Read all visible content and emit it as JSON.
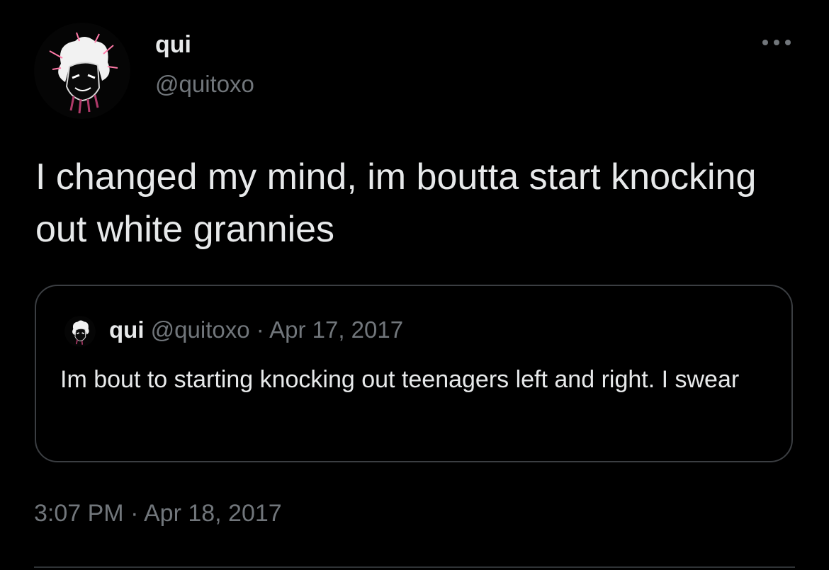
{
  "tweet": {
    "author": {
      "name": "qui",
      "handle": "@quitoxo",
      "avatar_icon": "avatar-image"
    },
    "more_icon": "more-horizontal-icon",
    "text": "I changed my mind, im boutta start knocking out white grannies",
    "quoted": {
      "name": "qui",
      "handle": "@quitoxo",
      "separator": "·",
      "date": "Apr 17, 2017",
      "text": "Im bout to starting knocking out teenagers left and right. I swear"
    },
    "time": "3:07 PM",
    "time_separator": "·",
    "date": "Apr 18, 2017"
  },
  "colors": {
    "background": "#000000",
    "primary_text": "#e7e9ea",
    "secondary_text": "#71767b",
    "border": "#3b3e42"
  }
}
